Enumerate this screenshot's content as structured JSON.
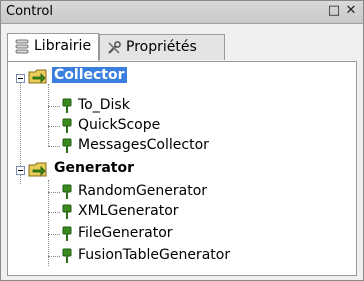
{
  "window": {
    "title": "Control",
    "restore_glyph": "□",
    "close_glyph": "✕"
  },
  "tabs": [
    {
      "label": "Librairie",
      "icon": "library-stack-icon",
      "active": true
    },
    {
      "label": "Propriétés",
      "icon": "tools-icon",
      "active": false
    }
  ],
  "tree": {
    "groups": [
      {
        "label": "Collector",
        "selected": true,
        "icon": "folder-arrow-icon",
        "items": [
          {
            "label": "To_Disk",
            "icon": "plug-icon"
          },
          {
            "label": "QuickScope",
            "icon": "plug-icon"
          },
          {
            "label": "MessagesCollector",
            "icon": "plug-icon"
          }
        ]
      },
      {
        "label": "Generator",
        "selected": false,
        "icon": "folder-arrow-icon",
        "items": [
          {
            "label": "RandomGenerator",
            "icon": "plug-icon"
          },
          {
            "label": "XMLGenerator",
            "icon": "plug-icon"
          },
          {
            "label": "FileGenerator",
            "icon": "plug-icon"
          },
          {
            "label": "FusionTableGenerator",
            "icon": "plug-icon"
          }
        ]
      }
    ]
  },
  "colors": {
    "selection": "#3a7fe0",
    "plug_green": "#3a8a1f",
    "folder_yellow": "#e8cc5a"
  }
}
